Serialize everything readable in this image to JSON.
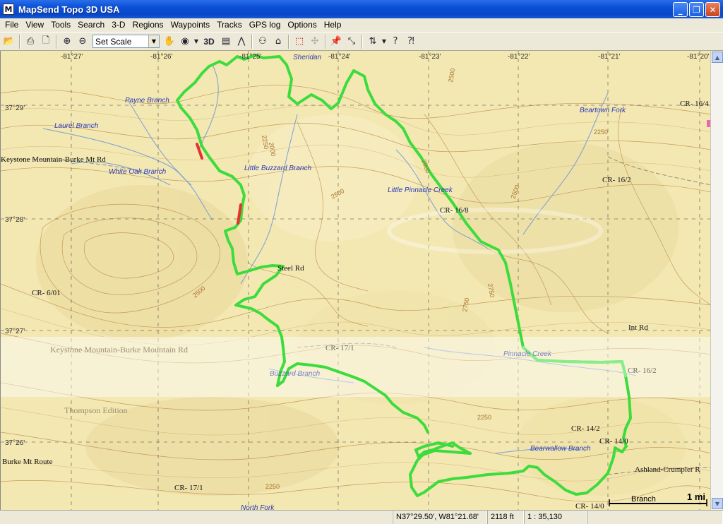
{
  "window": {
    "title": "MapSend Topo 3D USA",
    "icon_letter": "M"
  },
  "menu": [
    "File",
    "View",
    "Tools",
    "Search",
    "3-D",
    "Regions",
    "Waypoints",
    "Tracks",
    "GPS log",
    "Options",
    "Help"
  ],
  "toolbar": {
    "scale_value": "Set Scale",
    "three_d_label": "3D"
  },
  "map": {
    "lon_ticks": [
      "-81°27'",
      "-81°26'",
      "-81°25'",
      "-81°24'",
      "-81°23'",
      "-81°22'",
      "-81°21'",
      "-81°20'"
    ],
    "lat_ticks": [
      "37°29'",
      "37°28'",
      "37°27'",
      "37°26'"
    ],
    "water_labels": [
      "Payne Branch",
      "Laurel Branch",
      "White Oak Branch",
      "Little Buzzard Branch",
      "Little Pinnacle Creek",
      "Beartown Fork",
      "Pinnacle Creek",
      "Buzzard Branch",
      "Bearwallow Branch",
      "Branch",
      "North Fork"
    ],
    "road_labels": [
      "Sheridan",
      "CR- 16/4",
      "Keystone Mountain-Burke Mt Rd",
      "CR- 16/2",
      "CR- 16/8",
      "Steel Rd",
      "CR- 6/01",
      "Int Rd",
      "CR- 17/1",
      "CR- 16/2",
      "CR- 14/2",
      "CR- 14/0",
      "Burke Mt Route",
      "CR- 17/1",
      "Ashland-Crumpler R",
      "CR- 14/0"
    ],
    "contour_labels": [
      "2250",
      "2000",
      "2500",
      "2000",
      "2500",
      "2500",
      "2750",
      "2250",
      "2500",
      "2750",
      "2250",
      "2250"
    ],
    "watermark": {
      "line1": "Keystone Mountain-Burke Mountain Rd",
      "line2": "Thompson Edition"
    },
    "scale_bar": "1 mi",
    "colors": {
      "track": "#3ddc3d",
      "track_highlight": "#e83030",
      "water": "#2a3ab8",
      "paper": "#f3e7b2"
    }
  },
  "status": {
    "coords": "N37°29.50', W81°21.68'",
    "elevation": "2118 ft",
    "scale": "1 : 35,130"
  }
}
